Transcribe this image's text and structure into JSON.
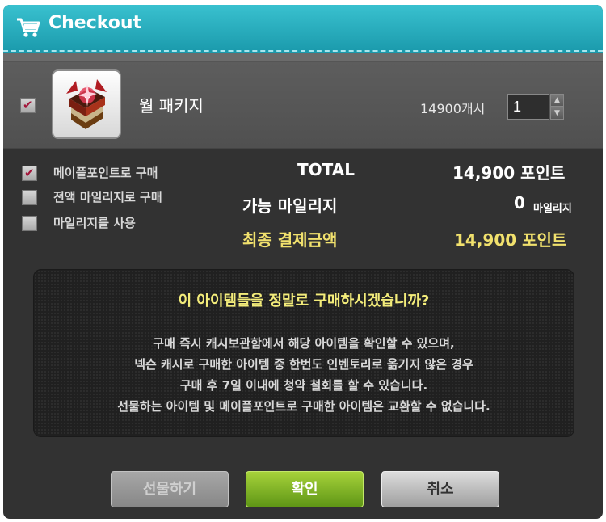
{
  "window": {
    "title": "Checkout",
    "icons": {
      "title": "shopping-cart-icon",
      "item": "book-item-icon"
    }
  },
  "item": {
    "checked": true,
    "name": "월 패키지",
    "price": "14900캐시",
    "quantity": "1"
  },
  "options": [
    {
      "label": "메이플포인트로 구매",
      "checked": true
    },
    {
      "label": "전액 마일리지로 구매",
      "checked": false
    },
    {
      "label": "마일리지를 사용",
      "checked": false
    }
  ],
  "summary": {
    "total_label": "TOTAL",
    "total_value": "14,900 포인트",
    "mileage_label": "가능 마일리지",
    "mileage_value": "0",
    "mileage_unit": "마일리지",
    "final_label": "최종 결제금액",
    "final_value": "14,900 포인트"
  },
  "confirm": {
    "title": "이 아이템들을 정말로 구매하시겠습니까?",
    "lines": [
      "구매 즉시 캐시보관함에서 해당 아이템을 확인할 수 있으며,",
      "넥슨 캐시로 구매한 아이템 중 한번도 인벤토리로 옮기지 않은 경우",
      "구매 후 7일 이내에 청약 철회를 할 수 있습니다.",
      "선물하는 아이템 및 메이플포인트로 구매한 아이템은 교환할 수 없습니다."
    ]
  },
  "buttons": {
    "gift": "선물하기",
    "confirm": "확인",
    "cancel": "취소"
  },
  "colors": {
    "titlebar": "#1fa8b9",
    "checkmark": "#a3153a",
    "highlight": "#f1e16d",
    "confirm_button": "#7fb524"
  }
}
